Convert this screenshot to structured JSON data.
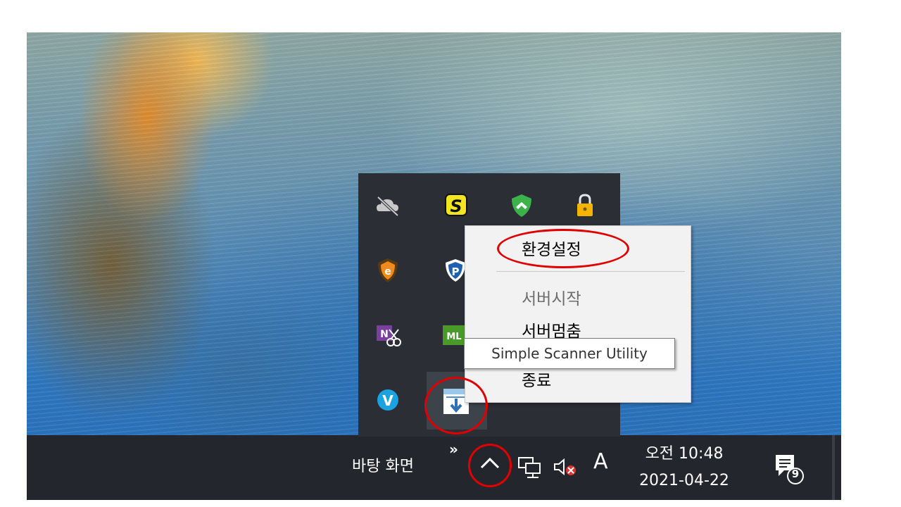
{
  "taskbar": {
    "desktop_label": "바탕 화면",
    "more_toolbar_glyph": "»",
    "overflow_icon": "chevron-up-icon",
    "network_icon": "network-icon",
    "volume_icon": "volume-muted-icon",
    "ime_indicator": "A",
    "clock_time": "오전 10:48",
    "clock_date": "2021-04-22",
    "notification_count": "9"
  },
  "tray_overflow": {
    "icons": [
      {
        "name": "onedrive-offline-icon"
      },
      {
        "name": "s-app-icon"
      },
      {
        "name": "green-shield-icon"
      },
      {
        "name": "lock-icon"
      },
      {
        "name": "orange-shield-icon"
      },
      {
        "name": "parking-shield-icon"
      },
      {
        "name": "nx-scissors-icon"
      },
      {
        "name": "ml-green-icon"
      },
      {
        "name": "v-blue-icon"
      },
      {
        "name": "simple-scanner-icon"
      }
    ]
  },
  "context_menu": {
    "items": [
      {
        "label": "환경설정",
        "enabled": true
      },
      {
        "label": "서버시작",
        "enabled": false
      },
      {
        "label": "서버멈춤",
        "enabled": true
      },
      {
        "label": "종료",
        "enabled": true
      }
    ]
  },
  "tooltip": {
    "text": "Simple Scanner Utility"
  },
  "colors": {
    "taskbar": "#23272d",
    "tray_popup": "#2b2f35",
    "menu_bg": "#f2f2f2",
    "annotation": "#e00000"
  }
}
